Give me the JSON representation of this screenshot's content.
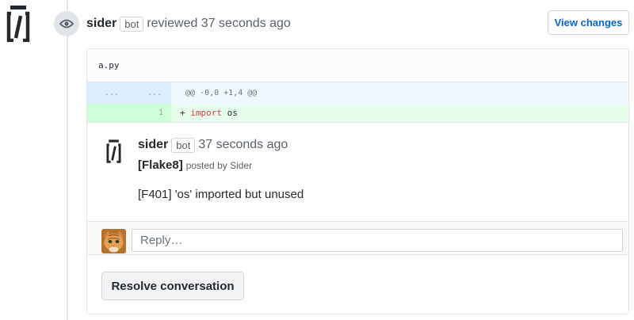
{
  "review_header": {
    "author": "sider",
    "bot_label": "bot",
    "action_text": "reviewed 37 seconds ago",
    "view_changes_label": "View changes"
  },
  "diff": {
    "file_name": "a.py",
    "hunk": {
      "left_gutter": "...",
      "right_gutter": "...",
      "header": "@@ -0,0 +1,4 @@"
    },
    "added_line": {
      "number": "1",
      "prefix": "+ ",
      "keyword": "import",
      "rest": " os"
    }
  },
  "comment": {
    "author": "sider",
    "bot_label": "bot",
    "time": "37 seconds ago",
    "tag": "[Flake8]",
    "posted_by": "posted by Sider",
    "body": "[F401] 'os' imported but unused"
  },
  "reply": {
    "placeholder": "Reply…"
  },
  "resolve": {
    "label": "Resolve conversation"
  },
  "colors": {
    "link": "#0366d6",
    "addition_bg": "#e6ffed",
    "hunk_bg": "#f1f8ff",
    "keyword": "#d73a49"
  },
  "icons": {
    "app_logo": "sider-logo-icon",
    "review_badge": "eye-icon",
    "reply_avatar": "cat-avatar"
  }
}
